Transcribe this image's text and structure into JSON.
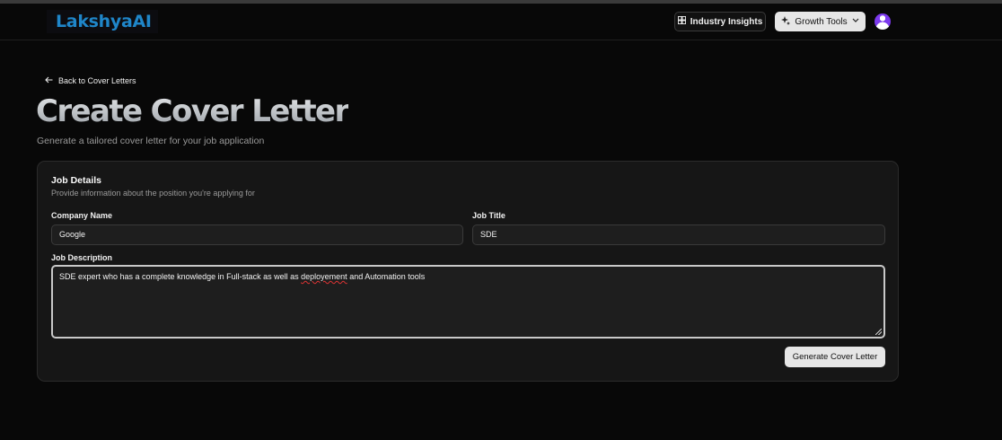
{
  "app": {
    "logo_text": "LakshyaAI"
  },
  "header": {
    "industry_insights_label": "Industry Insights",
    "growth_tools_label": "Growth Tools",
    "icons": {
      "insights": "layout-dashboard-icon",
      "growth": "stars-icon",
      "dropdown": "chevron-down-icon",
      "profile": "user-avatar-icon"
    }
  },
  "nav": {
    "back_label": "Back to Cover Letters",
    "back_icon": "arrow-left-icon"
  },
  "page": {
    "title": "Create Cover Letter",
    "subtitle": "Generate a tailored cover letter for your job application"
  },
  "card": {
    "title": "Job Details",
    "description": "Provide information about the position you're applying for",
    "fields": {
      "company_name": {
        "label": "Company Name",
        "value": "Google"
      },
      "job_title": {
        "label": "Job Title",
        "value": "SDE"
      },
      "job_description": {
        "label": "Job Description",
        "value_before": "SDE expert who has a complete knowledge in Full-stack as well as ",
        "misspelled": "deployement",
        "value_after": " and Automation tools"
      }
    },
    "generate_label": "Generate Cover Letter"
  },
  "colors": {
    "background": "#080808",
    "card": "#161616",
    "logo": "#1f86c9",
    "avatar": "#7c3aed",
    "spellcheck": "#dd3333"
  }
}
